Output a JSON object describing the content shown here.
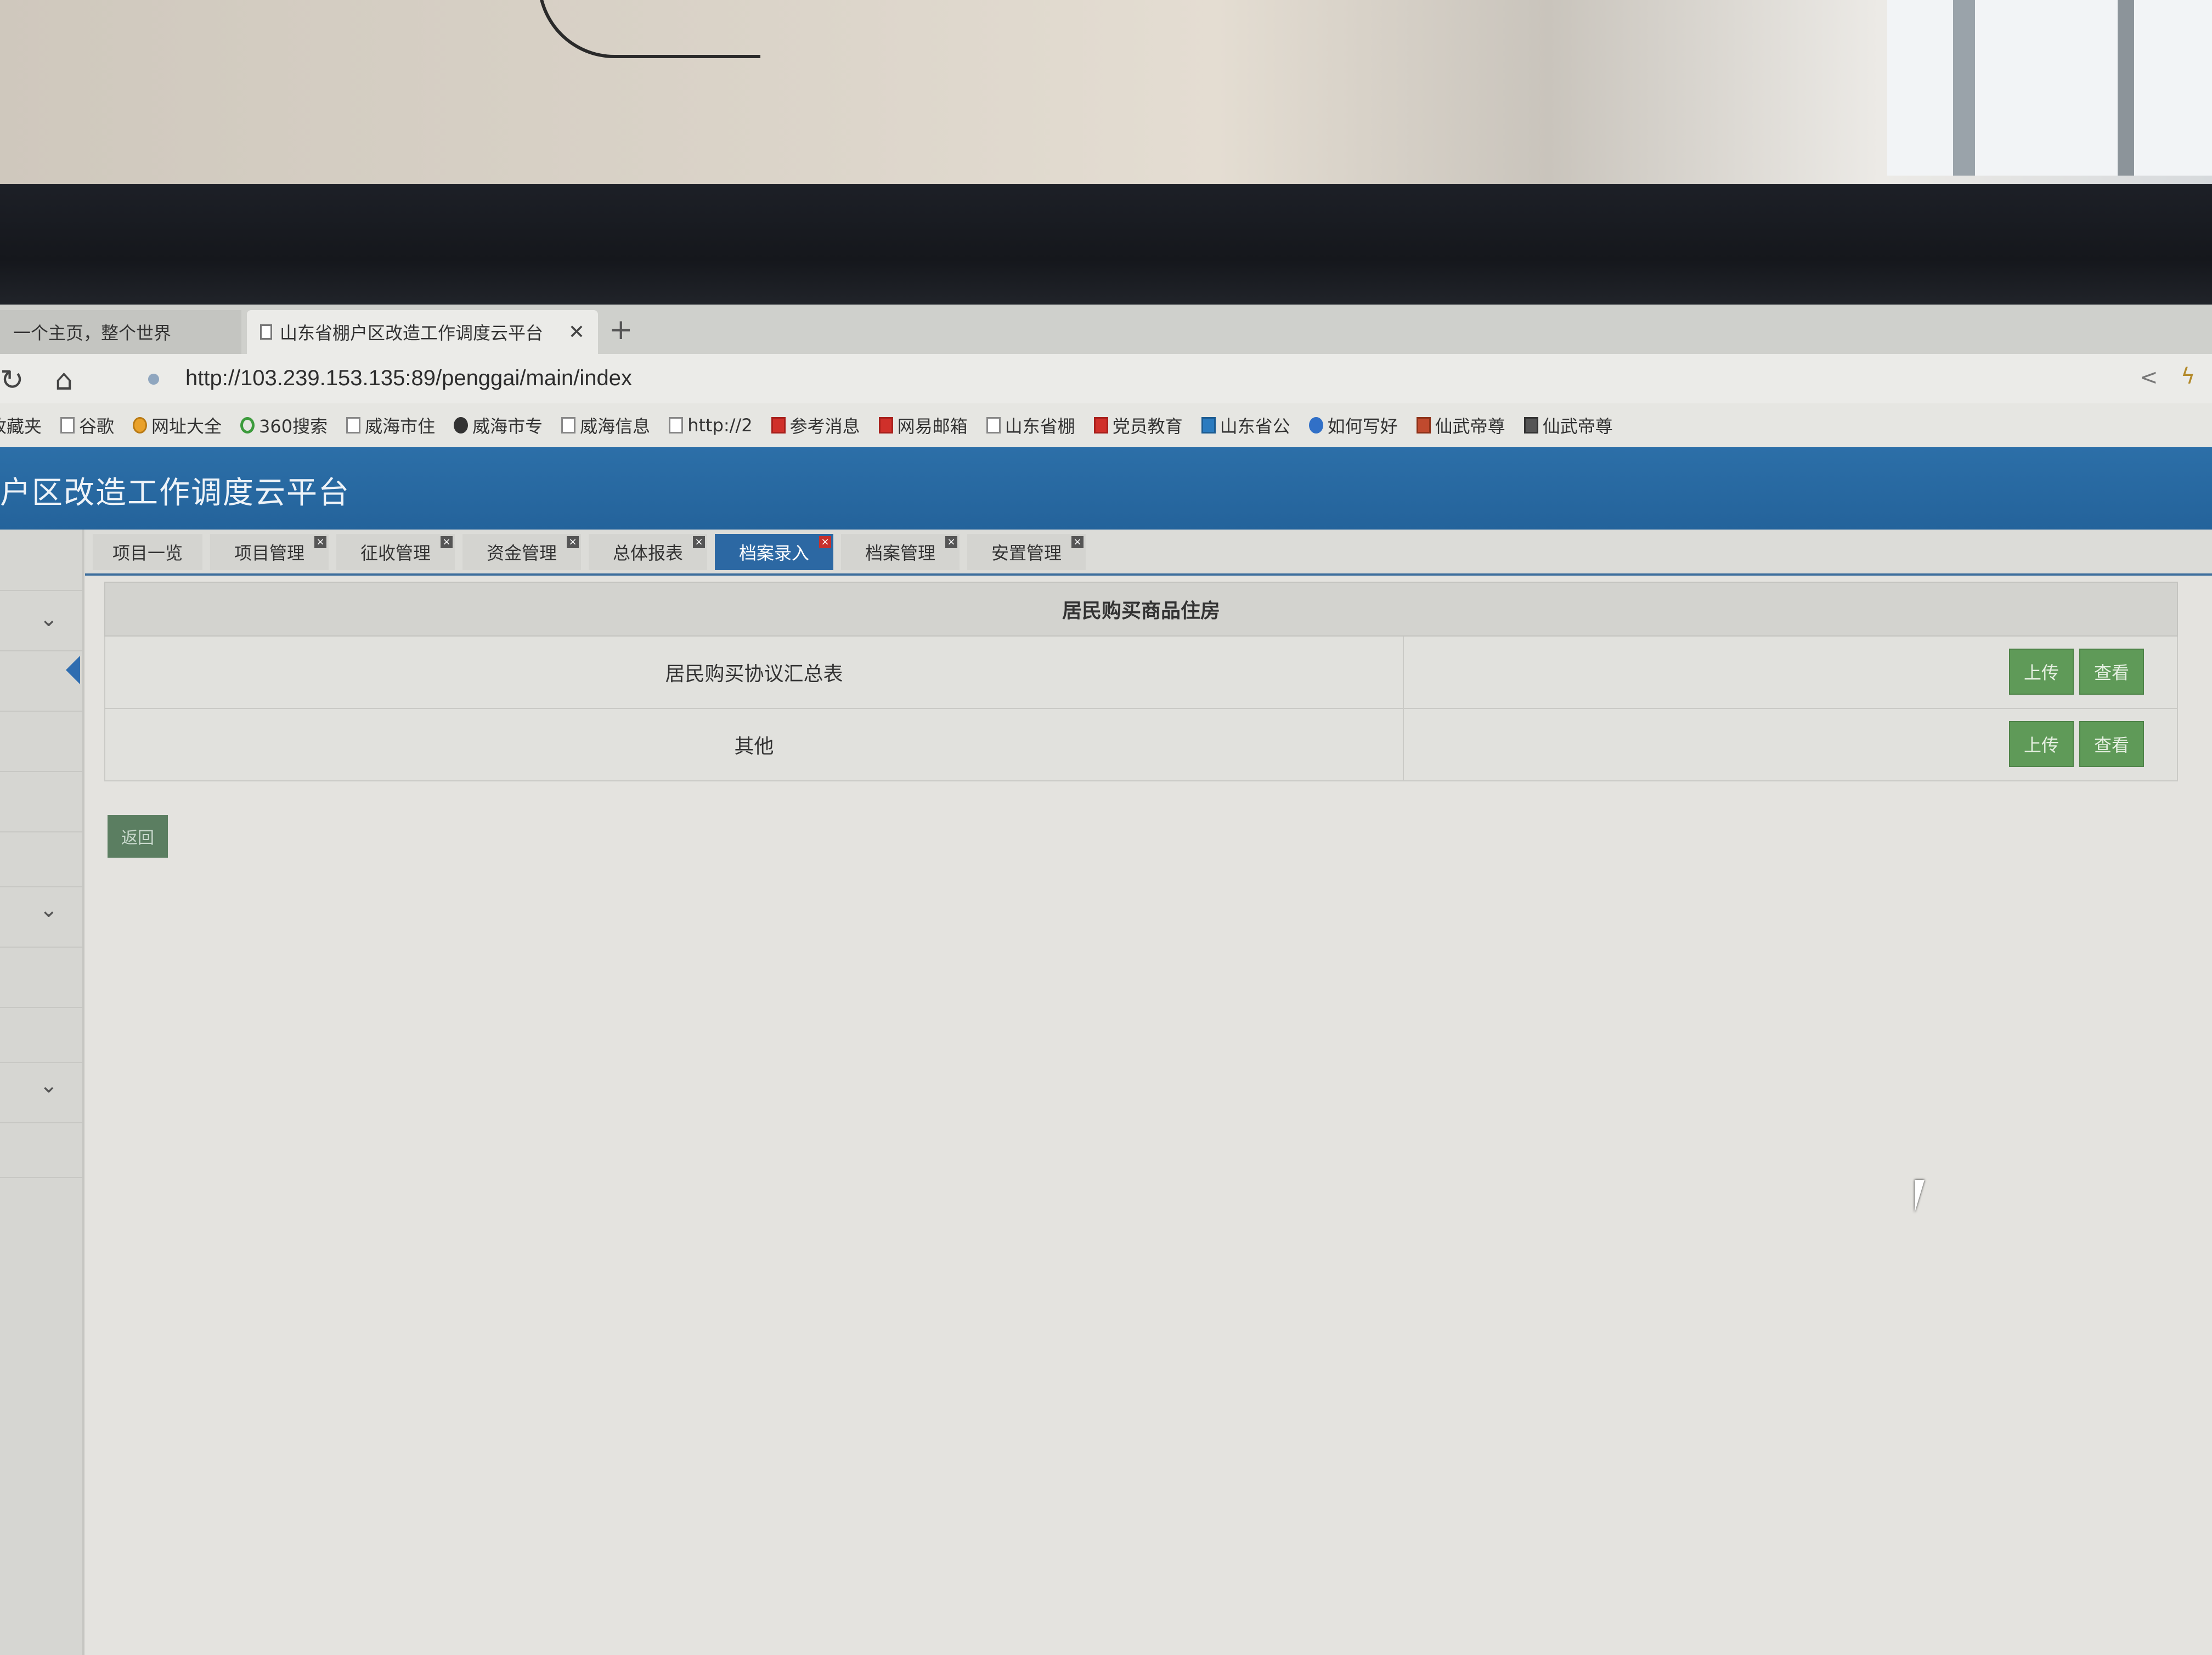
{
  "browser": {
    "tabs": [
      {
        "label": "一个主页，整个世界"
      },
      {
        "label": "山东省棚户区改造工作调度云平台"
      }
    ],
    "close_glyph": "✕",
    "new_tab_glyph": "+",
    "url": "http://103.239.153.135:89/penggai/main/index",
    "bookmarks": [
      {
        "label": "收藏夹",
        "icon": "star-icon"
      },
      {
        "label": "谷歌",
        "icon": "page-icon"
      },
      {
        "label": "网址大全",
        "icon": "globe-icon"
      },
      {
        "label": "360搜索",
        "icon": "search-360-icon"
      },
      {
        "label": "威海市住",
        "icon": "page-icon"
      },
      {
        "label": "威海市专",
        "icon": "e-icon"
      },
      {
        "label": "威海信息",
        "icon": "page-icon"
      },
      {
        "label": "http://2",
        "icon": "page-icon"
      },
      {
        "label": "参考消息",
        "icon": "news-icon"
      },
      {
        "label": "网易邮箱",
        "icon": "mail-163-icon"
      },
      {
        "label": "山东省棚",
        "icon": "page-icon"
      },
      {
        "label": "党员教育",
        "icon": "party-icon"
      },
      {
        "label": "山东省公",
        "icon": "mail-icon"
      },
      {
        "label": "如何写好",
        "icon": "baidu-paw-icon"
      },
      {
        "label": "仙武帝尊",
        "icon": "house-icon"
      },
      {
        "label": "仙武帝尊",
        "icon": "book-icon"
      }
    ]
  },
  "app": {
    "title": "户区改造工作调度云平台",
    "tabs": [
      {
        "label": "项目一览",
        "closable": false
      },
      {
        "label": "项目管理",
        "closable": true
      },
      {
        "label": "征收管理",
        "closable": true
      },
      {
        "label": "资金管理",
        "closable": true
      },
      {
        "label": "总体报表",
        "closable": true
      },
      {
        "label": "档案录入",
        "closable": true,
        "active": true
      },
      {
        "label": "档案管理",
        "closable": true
      },
      {
        "label": "安置管理",
        "closable": true
      }
    ],
    "tab_close_glyph": "×",
    "panel": {
      "header": "居民购买商品住房",
      "rows": [
        {
          "label": "居民购买协议汇总表",
          "upload": "上传",
          "view": "查看"
        },
        {
          "label": "其他",
          "upload": "上传",
          "view": "查看"
        }
      ]
    },
    "back_button": "返回"
  },
  "colors": {
    "header_blue": "#2c6fa8",
    "active_tab": "#2c68a3",
    "button_green": "#5f9a58"
  }
}
